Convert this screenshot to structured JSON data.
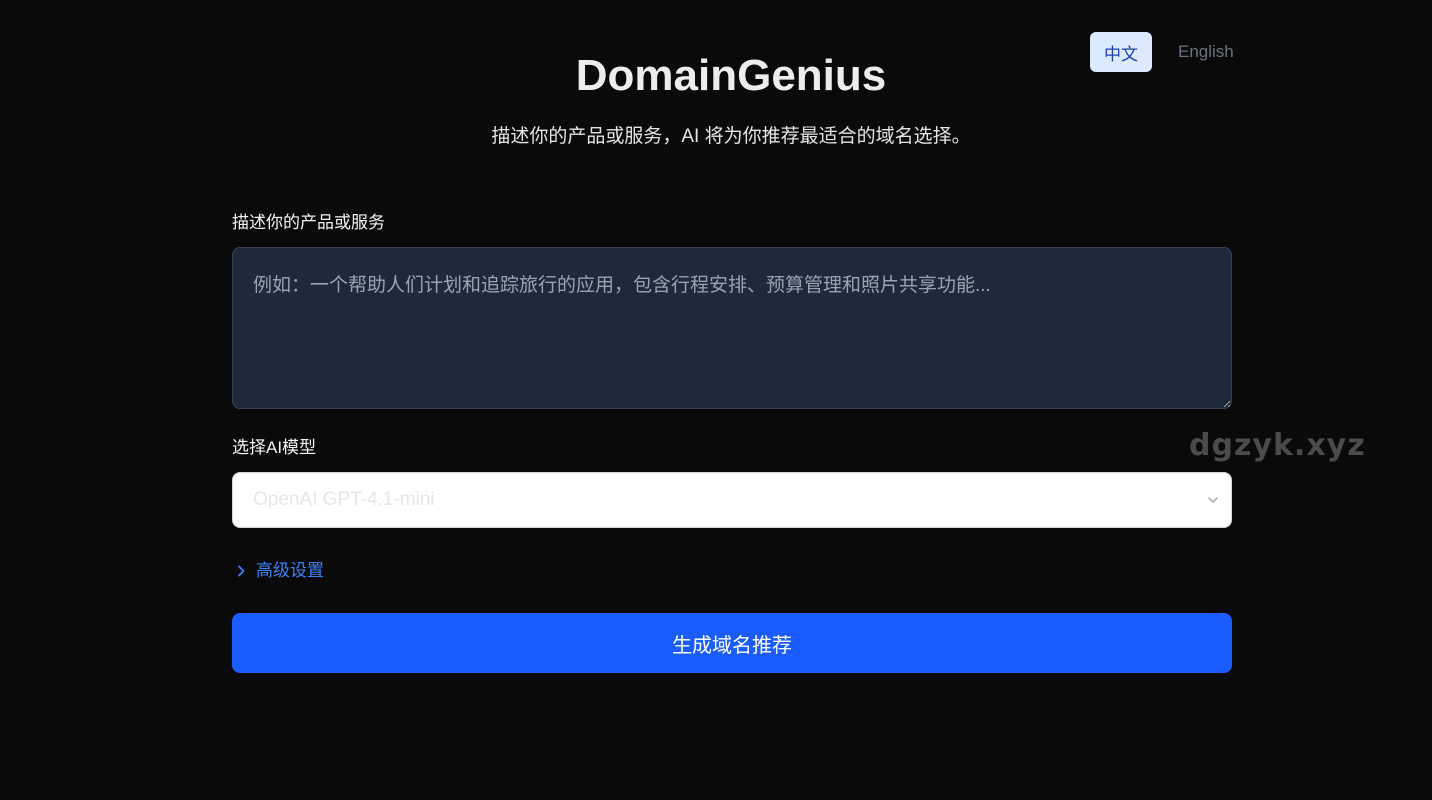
{
  "language": {
    "options": [
      "中文",
      "English"
    ],
    "active": "中文"
  },
  "header": {
    "title": "DomainGenius",
    "subtitle": "描述你的产品或服务，AI 将为你推荐最适合的域名选择。"
  },
  "form": {
    "description_label": "描述你的产品或服务",
    "description_placeholder": "例如：一个帮助人们计划和追踪旅行的应用，包含行程安排、预算管理和照片共享功能...",
    "description_value": "",
    "model_label": "选择AI模型",
    "model_selected": "OpenAI GPT-4.1-mini",
    "advanced_label": "高级设置",
    "submit_label": "生成域名推荐"
  },
  "watermark": "dgzyk.xyz",
  "colors": {
    "background": "#0a0a0a",
    "accent": "#1a5cff",
    "link": "#3b82f6",
    "textarea_bg": "#1e293b",
    "active_lang_bg": "#dbeafe"
  },
  "icons": {
    "select": "chevron-down-icon",
    "advanced": "chevron-right-icon"
  }
}
